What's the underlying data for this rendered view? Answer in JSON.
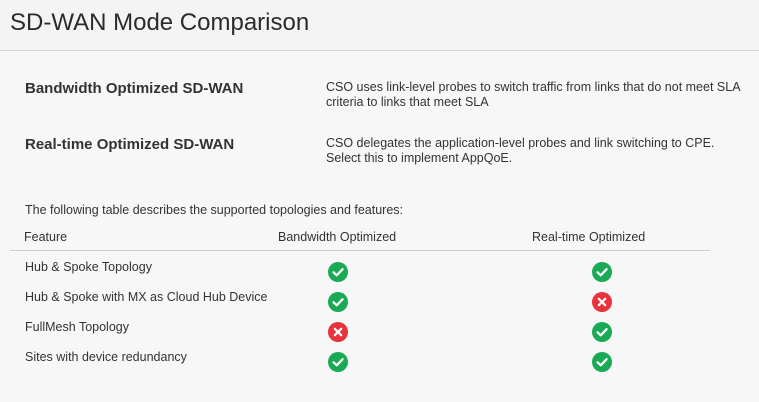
{
  "page": {
    "title": "SD-WAN Mode Comparison"
  },
  "modes": [
    {
      "name": "Bandwidth Optimized SD-WAN",
      "description": "CSO uses link-level probes to switch traffic from links that do not meet SLA criteria to links that meet SLA"
    },
    {
      "name": "Real-time Optimized SD-WAN",
      "description": "CSO delegates the application-level probes and link switching to CPE. Select this to implement AppQoE."
    }
  ],
  "table": {
    "intro": "The following table describes the supported topologies and features:",
    "headers": {
      "feature": "Feature",
      "bandwidth": "Bandwidth Optimized",
      "realtime": "Real-time Optimized"
    },
    "rows": [
      {
        "feature": "Hub & Spoke Topology",
        "bandwidth": "check-icon",
        "realtime": "check-icon"
      },
      {
        "feature": "Hub & Spoke with MX as Cloud Hub Device",
        "bandwidth": "check-icon",
        "realtime": "cross-icon"
      },
      {
        "feature": "FullMesh Topology",
        "bandwidth": "cross-icon",
        "realtime": "check-icon"
      },
      {
        "feature": "Sites with device redundancy",
        "bandwidth": "check-icon",
        "realtime": "check-icon"
      }
    ]
  },
  "colors": {
    "supported": "#1aaa55",
    "unsupported": "#e8323c"
  }
}
